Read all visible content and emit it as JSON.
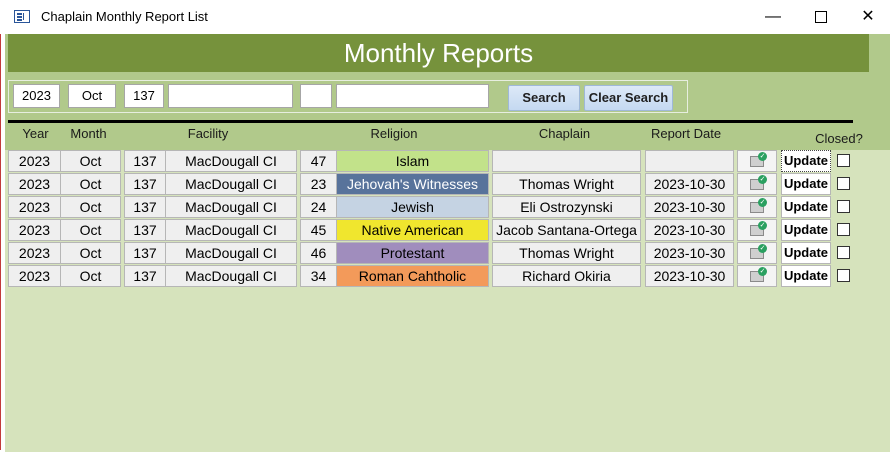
{
  "window": {
    "title": "Chaplain Monthly Report List",
    "minimize": "—",
    "close": "✕"
  },
  "banner": {
    "title": "Monthly Reports"
  },
  "search": {
    "year": "2023",
    "month": "Oct",
    "facility_id": "137",
    "facility": "",
    "religion_id": "",
    "religion": "",
    "search_label": "Search",
    "clear_label": "Clear Search"
  },
  "columns": {
    "year": "Year",
    "month": "Month",
    "facility": "Facility",
    "religion": "Religion",
    "chaplain": "Chaplain",
    "report_date": "Report Date",
    "closed": "Closed?"
  },
  "colors": {
    "banner": "#76923c",
    "header_band": "#b1c98b",
    "body": "#d6e3bc"
  },
  "rows": [
    {
      "year": "2023",
      "month": "Oct",
      "facility_id": "137",
      "facility": "MacDougall CI",
      "religion_id": "47",
      "religion": "Islam",
      "religion_color": "#c2e28a",
      "religion_text": "#000000",
      "chaplain": "",
      "report_date": "",
      "update": "Update",
      "closed": false
    },
    {
      "year": "2023",
      "month": "Oct",
      "facility_id": "137",
      "facility": "MacDougall CI",
      "religion_id": "23",
      "religion": "Jehovah's Witnesses",
      "religion_color": "#58739b",
      "religion_text": "#ffffff",
      "chaplain": "Thomas Wright",
      "report_date": "2023-10-30",
      "update": "Update",
      "closed": false
    },
    {
      "year": "2023",
      "month": "Oct",
      "facility_id": "137",
      "facility": "MacDougall CI",
      "religion_id": "24",
      "religion": "Jewish",
      "religion_color": "#c5d3e3",
      "religion_text": "#000000",
      "chaplain": "Eli Ostrozynski",
      "report_date": "2023-10-30",
      "update": "Update",
      "closed": false
    },
    {
      "year": "2023",
      "month": "Oct",
      "facility_id": "137",
      "facility": "MacDougall CI",
      "religion_id": "45",
      "religion": "Native American",
      "religion_color": "#f0e62e",
      "religion_text": "#000000",
      "chaplain": "Jacob Santana-Ortega",
      "report_date": "2023-10-30",
      "update": "Update",
      "closed": false
    },
    {
      "year": "2023",
      "month": "Oct",
      "facility_id": "137",
      "facility": "MacDougall CI",
      "religion_id": "46",
      "religion": "Protestant",
      "religion_color": "#a08dbd",
      "religion_text": "#000000",
      "chaplain": "Thomas Wright",
      "report_date": "2023-10-30",
      "update": "Update",
      "closed": false
    },
    {
      "year": "2023",
      "month": "Oct",
      "facility_id": "137",
      "facility": "MacDougall CI",
      "religion_id": "34",
      "religion": "Roman Cahtholic",
      "religion_color": "#f39a5a",
      "religion_text": "#000000",
      "chaplain": "Richard Okiria",
      "report_date": "2023-10-30",
      "update": "Update",
      "closed": false
    }
  ]
}
